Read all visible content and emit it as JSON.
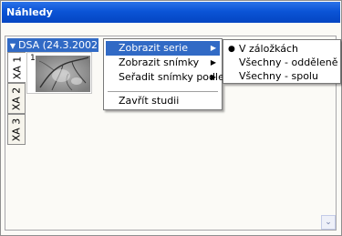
{
  "window": {
    "title": "Náhledy"
  },
  "study": {
    "group_label": "DSA (24.3.2002)",
    "expand_icon": "▼"
  },
  "tabs": [
    {
      "label": "XA 1"
    },
    {
      "label": "XA 2"
    },
    {
      "label": "XA 3"
    }
  ],
  "thumbnail": {
    "number": "1"
  },
  "context_menu": {
    "items": [
      {
        "label": "Zobrazit serie",
        "has_submenu": true,
        "arrow": "▶"
      },
      {
        "label": "Zobrazit snímky",
        "has_submenu": true,
        "arrow": "▶"
      },
      {
        "label": "Seřadit snímky podle",
        "has_submenu": true,
        "arrow": "▶"
      },
      {
        "label": "Zavřít studii",
        "has_submenu": false
      }
    ]
  },
  "submenu": {
    "items": [
      {
        "label": "V záložkách",
        "checked": true,
        "mark": "●"
      },
      {
        "label": "Všechny - odděleně",
        "checked": false
      },
      {
        "label": "Všechny - spolu",
        "checked": false
      }
    ]
  },
  "scroll": {
    "down_glyph": "⌄"
  },
  "colors": {
    "titlebar": "#0b54d6",
    "highlight": "#316ac5"
  }
}
